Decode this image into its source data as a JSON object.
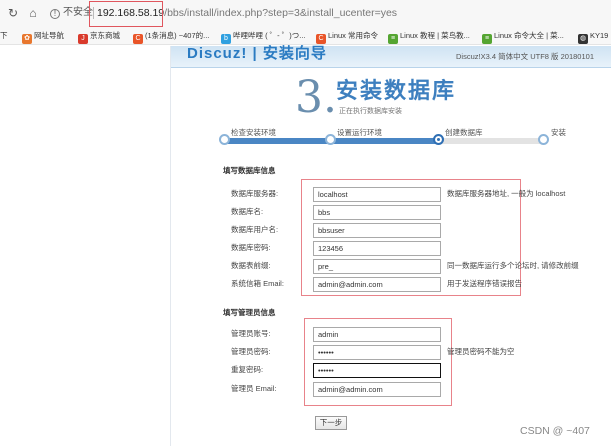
{
  "browser": {
    "security_label": "不安全",
    "url_host": "192.168.58.19",
    "url_rest": "/bbs/install/index.php?step=3&install_ucenter=yes"
  },
  "bookmarks": [
    {
      "label": "下",
      "icon": "none",
      "color": ""
    },
    {
      "label": "网址导航",
      "icon": "paw-icon",
      "color": "#e8772e"
    },
    {
      "label": "京东商城",
      "icon": "jd-icon",
      "color": "#d93a2c"
    },
    {
      "label": "(1条消息) ~407的...",
      "icon": "csdn-icon",
      "color": "#e95428"
    },
    {
      "label": "哔哩哔哩 ( ゜- ゜)つ...",
      "icon": "bilibili-icon",
      "color": "#2fa0e0"
    },
    {
      "label": "Linux 常用命令",
      "icon": "csdn-icon",
      "color": "#e95428"
    },
    {
      "label": "Linux 教程 | 菜鸟教...",
      "icon": "runoob-icon",
      "color": "#55a532"
    },
    {
      "label": "Linux 命令大全 | 菜...",
      "icon": "runoob-icon",
      "color": "#55a532"
    },
    {
      "label": "KY19",
      "icon": "globe-icon",
      "color": "#333333"
    }
  ],
  "installer": {
    "logo": "Discuz! | 安装向导",
    "version": "Discuz!X3.4 简体中文 UTF8 版 20180101",
    "step_number": "3.",
    "step_title": "安装数据库",
    "step_subtitle": "正在执行数据库安装",
    "progress_fraction": 0.68,
    "steps": [
      "检查安装环境",
      "设置运行环境",
      "创建数据库",
      "安装"
    ],
    "current_step": 3
  },
  "db_section": {
    "title": "填写数据库信息",
    "fields": [
      {
        "label": "数据库服务器:",
        "value": "localhost",
        "hint": "数据库服务器地址, 一般为 localhost"
      },
      {
        "label": "数据库名:",
        "value": "bbs",
        "hint": ""
      },
      {
        "label": "数据库用户名:",
        "value": "bbsuser",
        "hint": ""
      },
      {
        "label": "数据库密码:",
        "value": "123456",
        "hint": ""
      },
      {
        "label": "数据表前缀:",
        "value": "pre_",
        "hint": "同一数据库运行多个论坛时, 请修改前缀"
      },
      {
        "label": "系统信箱 Email:",
        "value": "admin@admin.com",
        "hint": "用于发送程序错误报告"
      }
    ]
  },
  "admin_section": {
    "title": "填写管理员信息",
    "fields": [
      {
        "label": "管理员账号:",
        "value": "admin",
        "hint": ""
      },
      {
        "label": "管理员密码:",
        "value": "••••••",
        "hint": "管理员密码不能为空"
      },
      {
        "label": "重复密码:",
        "value": "••••••",
        "hint": ""
      },
      {
        "label": "管理员 Email:",
        "value": "admin@admin.com",
        "hint": ""
      }
    ]
  },
  "next_button": "下一步",
  "watermark": "CSDN @ ~407"
}
